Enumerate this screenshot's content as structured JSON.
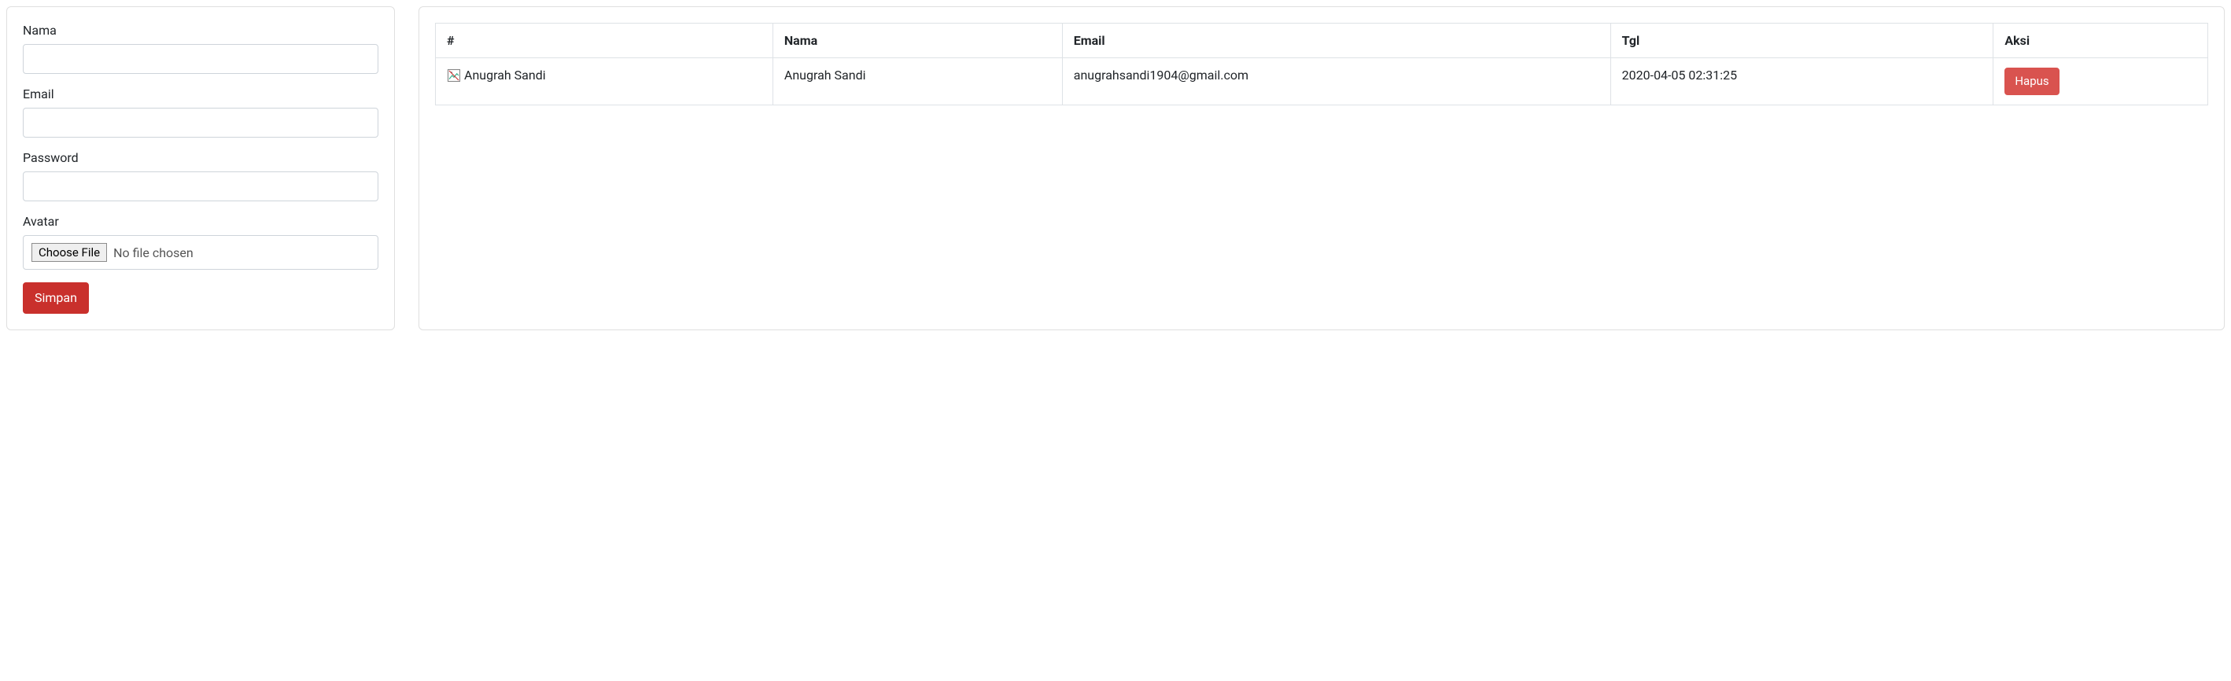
{
  "form": {
    "labels": {
      "nama": "Nama",
      "email": "Email",
      "password": "Password",
      "avatar": "Avatar"
    },
    "values": {
      "nama": "",
      "email": "",
      "password": ""
    },
    "file": {
      "choose_label": "Choose File",
      "status": "No file chosen"
    },
    "submit_label": "Simpan"
  },
  "table": {
    "headers": {
      "avatar": "#",
      "nama": "Nama",
      "email": "Email",
      "tgl": "Tgl",
      "aksi": "Aksi"
    },
    "rows": [
      {
        "avatar_alt": "Anugrah Sandi",
        "nama": "Anugrah Sandi",
        "email": "anugrahsandi1904@gmail.com",
        "tgl": "2020-04-05 02:31:25",
        "action_label": "Hapus"
      }
    ]
  }
}
